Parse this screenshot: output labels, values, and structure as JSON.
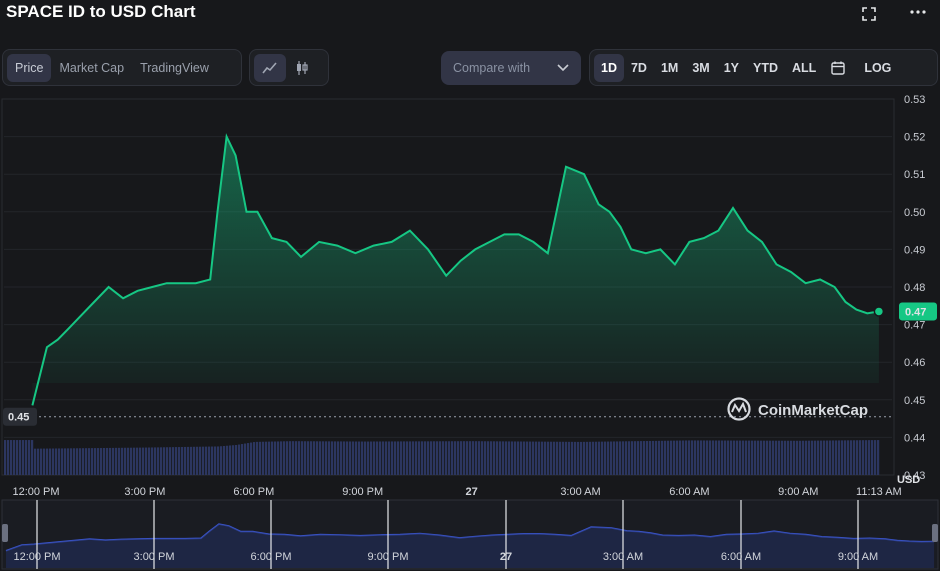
{
  "header": {
    "title": "SPACE ID to USD Chart"
  },
  "icons": {
    "fullscreen": "fullscreen-icon",
    "more": "more-icon",
    "calendar": "calendar-icon",
    "chevron": "chevron-down-icon",
    "line_chart": "line-chart-icon",
    "candlestick": "candlestick-icon"
  },
  "tabs": [
    {
      "label": "Price",
      "active": true
    },
    {
      "label": "Market Cap",
      "active": false
    },
    {
      "label": "TradingView",
      "active": false
    }
  ],
  "compare": {
    "label": "Compare with"
  },
  "ranges": [
    {
      "label": "1D",
      "active": true
    },
    {
      "label": "7D",
      "active": false
    },
    {
      "label": "1M",
      "active": false
    },
    {
      "label": "3M",
      "active": false
    },
    {
      "label": "1Y",
      "active": false
    },
    {
      "label": "YTD",
      "active": false
    },
    {
      "label": "ALL",
      "active": false
    }
  ],
  "log_label": "LOG",
  "watermark": "CoinMarketCap",
  "colors": {
    "line": "#16c784",
    "volume": "#2c3660",
    "accent": "#16c784",
    "background": "#17181b"
  },
  "chart_data": {
    "type": "area",
    "currency": "USD",
    "ylim": [
      0.43,
      0.53
    ],
    "y_ticks": [
      "0.53",
      "0.52",
      "0.51",
      "0.50",
      "0.49",
      "0.48",
      "0.47",
      "0.46",
      "0.45",
      "0.44",
      "0.43"
    ],
    "x_ticks": [
      "12:00 PM",
      "3:00 PM",
      "6:00 PM",
      "9:00 PM",
      "27",
      "3:00 AM",
      "6:00 AM",
      "9:00 AM",
      "11:13 AM"
    ],
    "navigator_ticks": [
      "12:00 PM",
      "3:00 PM",
      "6:00 PM",
      "9:00 PM",
      "27",
      "3:00 AM",
      "6:00 AM",
      "9:00 AM"
    ],
    "x_hours": [
      0,
      3,
      6,
      9,
      12,
      15,
      18,
      21,
      23.22
    ],
    "current_price": "0.47",
    "reference_price": "0.45",
    "reference_value": 0.4455,
    "series": [
      {
        "t": [
          -0.1,
          0.3,
          0.6,
          0.9,
          1.2,
          1.6,
          2.0,
          2.4,
          2.8,
          3.2,
          3.6,
          4.0,
          4.4,
          4.8,
          5.0,
          5.25,
          5.5,
          5.8,
          6.1,
          6.5,
          6.9,
          7.3,
          7.8,
          8.3,
          8.8,
          9.3,
          9.8,
          10.3,
          10.8,
          11.3,
          11.7,
          12.1,
          12.5,
          12.9,
          13.3,
          13.7,
          14.1,
          14.6,
          15.1,
          15.5,
          15.8,
          16.1,
          16.4,
          16.8,
          17.2,
          17.6,
          18.0,
          18.4,
          18.8,
          19.2,
          19.6,
          20.0,
          20.4,
          20.8,
          21.2,
          21.6,
          22.0,
          22.3,
          22.6,
          22.9,
          23.22
        ],
        "values": [
          0.4485,
          0.464,
          0.466,
          0.469,
          0.472,
          0.476,
          0.48,
          0.477,
          0.479,
          0.48,
          0.481,
          0.481,
          0.481,
          0.482,
          0.5,
          0.52,
          0.515,
          0.5,
          0.5,
          0.493,
          0.492,
          0.488,
          0.492,
          0.491,
          0.489,
          0.491,
          0.492,
          0.495,
          0.49,
          0.483,
          0.487,
          0.49,
          0.492,
          0.494,
          0.494,
          0.492,
          0.489,
          0.512,
          0.51,
          0.502,
          0.5,
          0.496,
          0.49,
          0.489,
          0.49,
          0.486,
          0.492,
          0.493,
          0.495,
          0.501,
          0.495,
          0.492,
          0.486,
          0.484,
          0.481,
          0.482,
          0.48,
          0.476,
          0.474,
          0.473,
          0.4735
        ]
      }
    ],
    "volume": {
      "t": [
        -0.1,
        1.0,
        3.0,
        5.0,
        5.5,
        6.0,
        7.0,
        9.0,
        12.0,
        15.0,
        18.0,
        21.0,
        23.22
      ],
      "values": [
        0.437,
        0.4371,
        0.4373,
        0.4376,
        0.438,
        0.4388,
        0.439,
        0.4389,
        0.439,
        0.4388,
        0.4392,
        0.4391,
        0.4393
      ]
    }
  }
}
